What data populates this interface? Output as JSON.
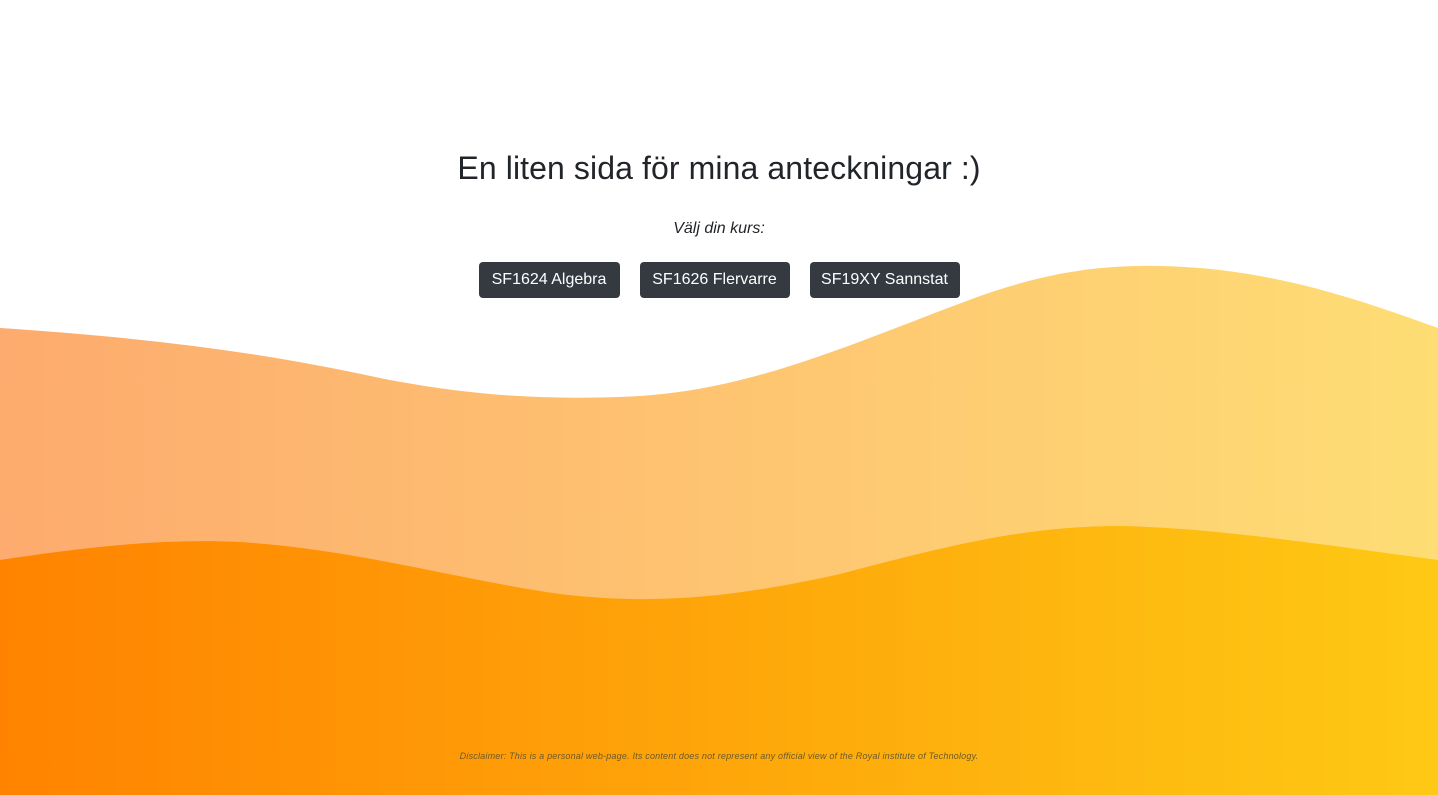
{
  "page": {
    "title": "En liten sida för mina anteckningar :)",
    "subtitle": "Välj din kurs:"
  },
  "courses": [
    {
      "label": "SF1624 Algebra"
    },
    {
      "label": "SF1626 Flervarre"
    },
    {
      "label": "SF19XY Sannstat"
    }
  ],
  "footer": {
    "disclaimer": "Disclaimer: This is a personal web-page. Its content does not represent any official view of the Royal institute of Technology."
  },
  "colors": {
    "background": "#ffffff",
    "button": "#343a40",
    "button_text": "#ffffff",
    "wave_back_left": "#fdab6e",
    "wave_back_right": "#fedd74",
    "wave_front_left": "#ff8300",
    "wave_front_right": "#fec914"
  }
}
